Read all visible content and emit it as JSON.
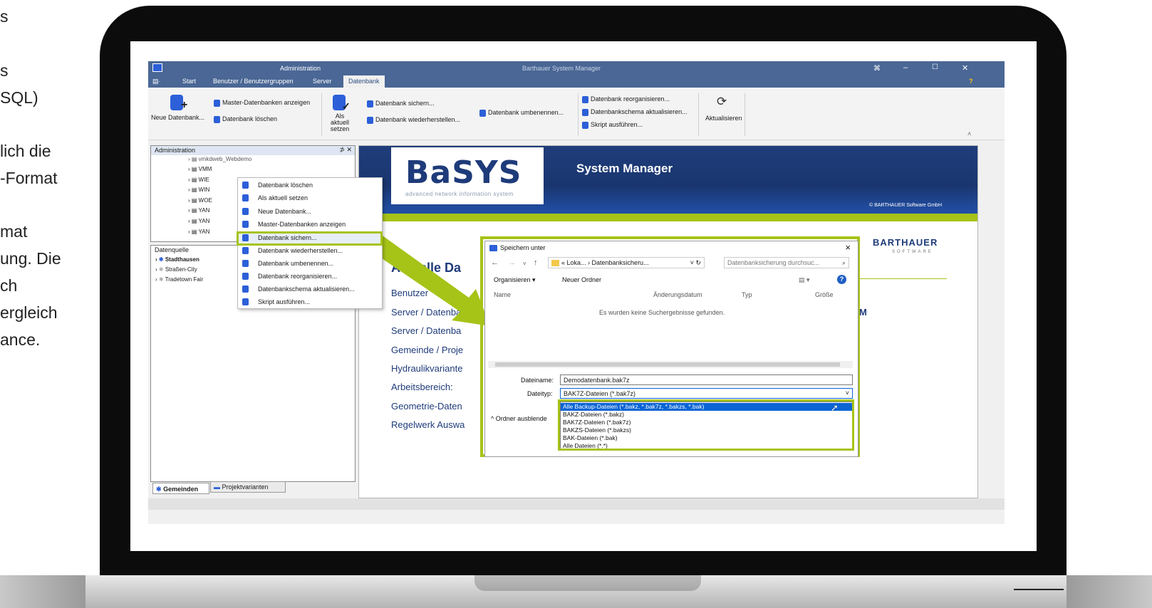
{
  "left_text": [
    "s",
    "s",
    "SQL)",
    "lich die",
    "-Format",
    "mat",
    "ung. Die",
    "ch",
    "ergleich",
    "ance."
  ],
  "app": {
    "ribbon_context": "Administration",
    "title": "Barthauer System Manager",
    "tabs": [
      "Start",
      "Benutzer / Benutzergruppen",
      "Server",
      "Datenbank"
    ],
    "active_tab": "Datenbank",
    "help": "?",
    "ribbon": {
      "new_db": "Neue Datenbank...",
      "show_master": "Master-Datenbanken anzeigen",
      "delete_db": "Datenbank löschen",
      "set_current": "Als aktuell setzen",
      "backup_db": "Datenbank sichern...",
      "restore_db": "Datenbank wiederherstellen...",
      "rename_db": "Datenbank umbenennen...",
      "reorganize_db": "Datenbank reorganisieren...",
      "update_schema": "Datenbankschema aktualisieren...",
      "run_script": "Skript ausführen...",
      "refresh": "Aktualisieren"
    },
    "admin_panel": {
      "title": "Administration",
      "items": [
        "vmkdweb_Webdemo",
        "VMM",
        "WIE",
        "WIN",
        "WOE",
        "YAN",
        "YAN",
        "YAN"
      ]
    },
    "datasource_panel": {
      "title": "Datenquelle",
      "items": [
        "Stadthausen",
        "Straßen-City",
        "Tradetown Fair"
      ]
    },
    "bottom_tabs": [
      "Gemeinden",
      "Projektvarianten"
    ],
    "context_menu": [
      "Datenbank löschen",
      "Als aktuell setzen",
      "Neue Datenbank...",
      "Master-Datenbanken anzeigen",
      "Datenbank sichern...",
      "Datenbank wiederherstellen...",
      "Datenbank umbenennen...",
      "Datenbank reorganisieren...",
      "Datenbankschema aktualisieren...",
      "Skript ausführen..."
    ],
    "content": {
      "logo": "BaSYS",
      "logo_sub": "advanced network information system",
      "product": "System Manager",
      "copyright": "© BARTHAUER Software GmbH",
      "brand": "BARTHAUER",
      "brand_sub": "SOFTWARE",
      "heading": "Aktuelle Da",
      "labels": [
        "Benutzer",
        "Server / Datenba",
        "Server / Datenba",
        "Gemeinde / Proje",
        "Hydraulikvariante",
        "Arbeitsbereich:",
        "Geometrie-Daten",
        "Regelwerk Auswa"
      ],
      "value_fragment": "LSUTM"
    }
  },
  "dialog": {
    "title": "Speichern unter",
    "close": "×",
    "breadcrumb": "«  Loka...  ›  Datenbanksicheru...",
    "search_placeholder": "Datenbanksicherung durchsuc...",
    "organize": "Organisieren ▾",
    "new_folder": "Neuer Ordner",
    "columns": [
      "Name",
      "Änderungsdatum",
      "Typ",
      "Größe"
    ],
    "empty": "Es wurden keine Suchergebnisse gefunden.",
    "filename_label": "Dateiname:",
    "filename": "Demodatenbank.bak7z",
    "filetype_label": "Dateityp:",
    "filetype": "BAK7Z-Dateien (*.bak7z)",
    "hide_folders": "Ordner ausblende",
    "filetype_options": [
      "Alle Backup-Dateien (*.bakz, *.bak7z, *.bakzs, *.bak)",
      "BAKZ-Dateien (*.bakz)",
      "BAK7Z-Dateien (*.bak7z)",
      "BAKZS-Dateien (*.bakzs)",
      "BAK-Dateien (*.bak)",
      "Alle Dateien (*.*)"
    ],
    "selected_option_index": 0
  },
  "colors": {
    "accent": "#a6c318",
    "title_bar": "#4a6795",
    "brand_blue": "#1e3b7a",
    "selection": "#0a64d4"
  }
}
